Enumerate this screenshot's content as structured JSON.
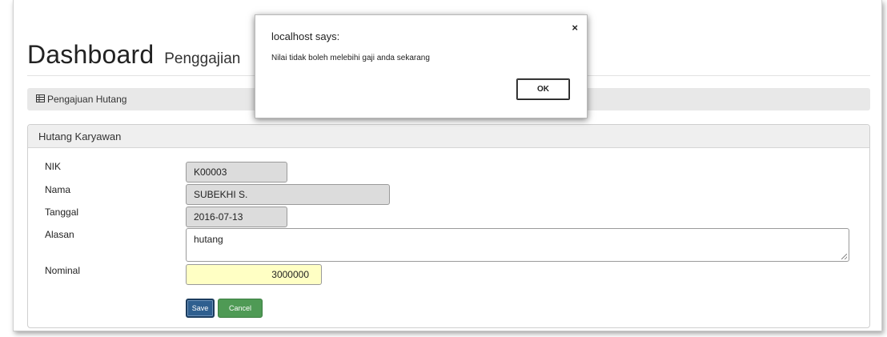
{
  "header": {
    "title": "Dashboard",
    "subtitle": "Penggajian"
  },
  "breadcrumb": {
    "icon": "table-icon",
    "label": "Pengajuan Hutang"
  },
  "panel": {
    "title": "Hutang Karyawan",
    "fields": {
      "nik": {
        "label": "NIK",
        "value": "K00003"
      },
      "nama": {
        "label": "Nama",
        "value": "SUBEKHI S."
      },
      "tanggal": {
        "label": "Tanggal",
        "value": "2016-07-13"
      },
      "alasan": {
        "label": "Alasan",
        "value": "hutang"
      },
      "nominal": {
        "label": "Nominal",
        "value": "3000000"
      }
    },
    "buttons": {
      "save": "Save",
      "cancel": "Cancel"
    }
  },
  "dialog": {
    "title": "localhost says:",
    "close": "×",
    "message": "Nilai tidak boleh melebihi gaji anda sekarang",
    "ok": "OK"
  },
  "colors": {
    "save": "#2f5f8f",
    "cancel": "#4f9a55",
    "nominal_bg": "#ffffc4"
  }
}
